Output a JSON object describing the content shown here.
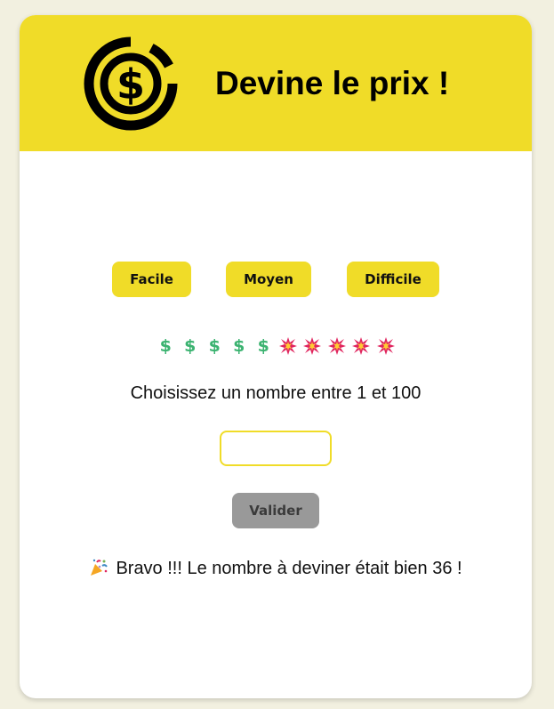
{
  "header": {
    "title": "Devine le prix !",
    "logo_icon": "dollar-coin-icon",
    "background": "#f0dc28"
  },
  "levels": {
    "easy": "Facile",
    "medium": "Moyen",
    "hard": "Difficile"
  },
  "tries": {
    "remaining_symbol": "$",
    "remaining_count": 5,
    "used_icon": "collision-icon",
    "used_count": 5
  },
  "game": {
    "prompt": "Choisissez un nombre entre 1 et 100",
    "input_value": "",
    "submit_label": "Valider",
    "result_icon": "party-popper-icon",
    "result_message": "Bravo !!! Le nombre à deviner était bien 36 !"
  },
  "colors": {
    "accent": "#f0dc28",
    "page_background": "#f2f0e0",
    "disabled_button": "#999999",
    "dollar_green": "#3cb371",
    "collision_red": "#e0245e"
  }
}
